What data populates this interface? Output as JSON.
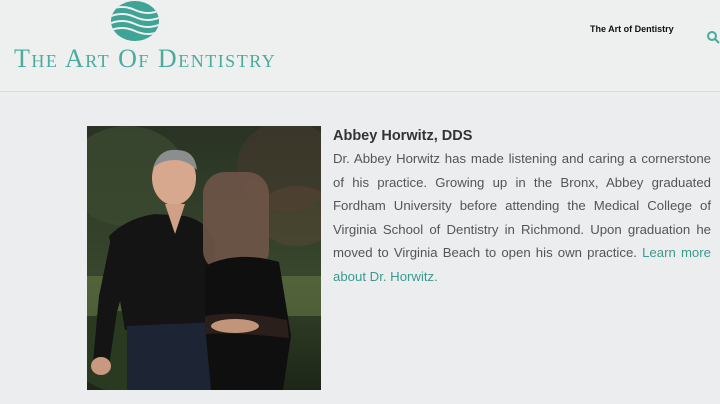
{
  "header": {
    "logo_text": "The Art Of Dentistry",
    "nav_item": "The Art of Dentistry",
    "search_icon": "search-icon"
  },
  "bio": {
    "name": "Abbey Horwitz, DDS",
    "paragraph": "Dr. Abbey Horwitz has made listening and caring a cornerstone of his practice. Growing up in the Bronx, Abbey graduated Fordham University before attending the Medical College of Virginia School of Dentistry in Richmond. Upon graduation he moved to Virginia Beach to open his own practice.",
    "link_text": "Learn more about Dr. Horwitz."
  },
  "colors": {
    "brand": "#4aab9f",
    "link": "#3b9a8e",
    "background": "#ecedee"
  }
}
